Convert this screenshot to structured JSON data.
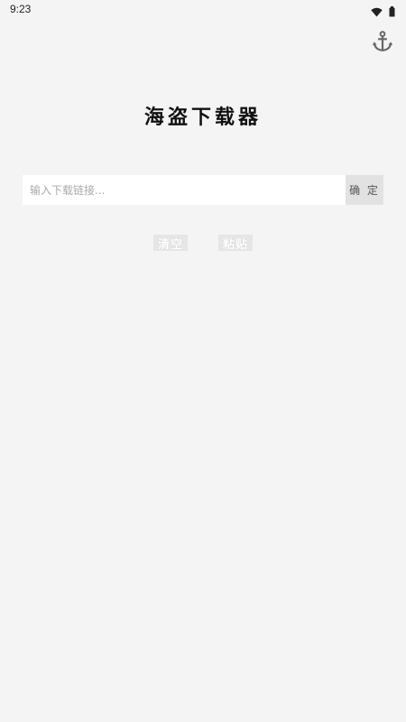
{
  "status_bar": {
    "time": "9:23",
    "icons": [
      "wifi-icon",
      "battery-icon"
    ]
  },
  "toolbar": {
    "settings_icon": "anchor-icon"
  },
  "main": {
    "title": "海盗下载器",
    "url_input": {
      "value": "",
      "placeholder": "输入下载链接..."
    },
    "confirm_label": "确 定",
    "clear_label": "清空",
    "paste_label": "粘贴"
  },
  "colors": {
    "background": "#f4f4f4",
    "input_background": "#ffffff",
    "confirm_background": "#e2e2e2",
    "action_background": "#e6e6e6",
    "icon_color": "#666666"
  }
}
